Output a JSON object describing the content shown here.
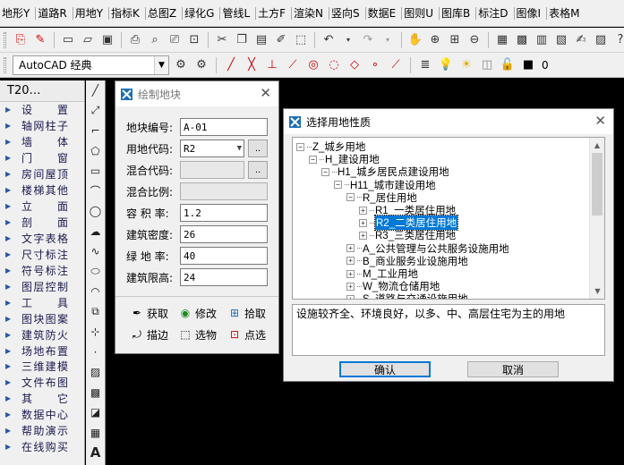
{
  "menubar": {
    "items": [
      "地形Y",
      "道路R",
      "用地Y",
      "指标K",
      "总图Z",
      "绿化G",
      "管线L",
      "土方F",
      "渲染N",
      "竖向S",
      "数据E",
      "图则U",
      "图库B",
      "标注D",
      "图像I",
      "表格M"
    ]
  },
  "toolbar2": {
    "workspace": "AutoCAD 经典",
    "layer": "0"
  },
  "sidebar": {
    "title": "T20…",
    "items": [
      "设　置",
      "轴网柱子",
      "墙　体",
      "门　窗",
      "房间屋顶",
      "楼梯其他",
      "立　面",
      "剖　面",
      "文字表格",
      "尺寸标注",
      "符号标注",
      "图层控制",
      "工　具",
      "图块图案",
      "建筑防火",
      "场地布置",
      "三维建模",
      "文件布图",
      "其　它",
      "数据中心",
      "帮助演示",
      "在线购买"
    ]
  },
  "dialog_parcel": {
    "title": "绘制地块",
    "fields": [
      {
        "label": "地块编号:",
        "value": "A-01"
      },
      {
        "label": "用地代码:",
        "value": "R2"
      },
      {
        "label": "混合代码:",
        "value": ""
      },
      {
        "label": "混合比例:",
        "value": ""
      },
      {
        "label": "容 积 率:",
        "value": "1.2"
      },
      {
        "label": "建筑密度:",
        "value": "26"
      },
      {
        "label": "绿 地 率:",
        "value": "40"
      },
      {
        "label": "建筑限高:",
        "value": "24"
      }
    ],
    "dots": "..",
    "actions": [
      "获取",
      "修改",
      "拾取",
      "描边",
      "选物",
      "点选"
    ]
  },
  "dialog_landuse": {
    "title": "选择用地性质",
    "tree": [
      {
        "label": "Z_城乡用地",
        "box": "−"
      },
      {
        "label": "H_建设用地",
        "box": "−"
      },
      {
        "label": "H1_城乡居民点建设用地",
        "box": "−"
      },
      {
        "label": "H11_城市建设用地",
        "box": "−"
      },
      {
        "label": "R_居住用地",
        "box": "−"
      },
      {
        "label": "R1_一类居住用地",
        "box": "+"
      },
      {
        "label": "R2_二类居住用地",
        "box": "+"
      },
      {
        "label": "R3_三类居住用地",
        "box": "+"
      },
      {
        "label": "A_公共管理与公共服务设施用地",
        "box": "+"
      },
      {
        "label": "B_商业服务业设施用地",
        "box": "+"
      },
      {
        "label": "M_工业用地",
        "box": "+"
      },
      {
        "label": "W_物流仓储用地",
        "box": "+"
      },
      {
        "label": "S_道路与交通设施用地",
        "box": "+"
      }
    ],
    "description": "设施较齐全、环境良好，以多、中、高层住宅为主的用地",
    "ok_label": "确认",
    "cancel_label": "取消"
  },
  "colors": {
    "selection": "#0078d7",
    "canvas": "#000000",
    "chrome": "#f0f0f0"
  }
}
